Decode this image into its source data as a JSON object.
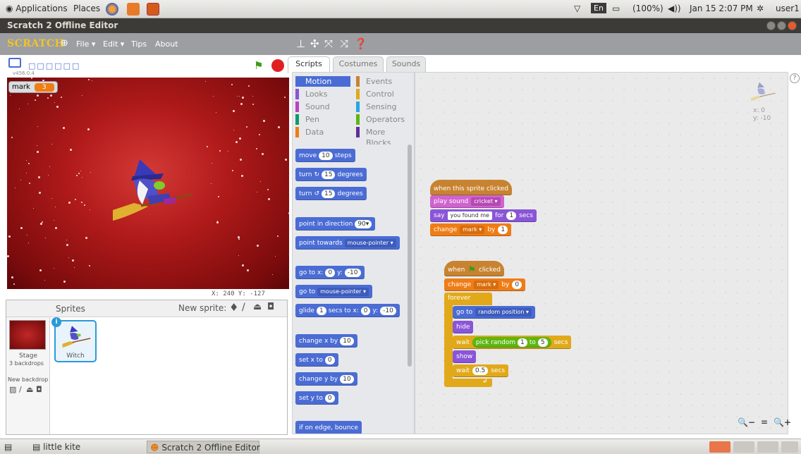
{
  "os_panel": {
    "applications": "Applications",
    "places": "Places",
    "keyboard_layout": "En",
    "battery": "(100%)",
    "datetime": "Jan 15  2:07 PM",
    "user": "user1"
  },
  "window": {
    "title": "Scratch 2 Offline Editor"
  },
  "menubar": {
    "logo": "SCRATCH",
    "file": "File ▾",
    "edit": "Edit ▾",
    "tips": "Tips",
    "about": "About"
  },
  "stage": {
    "version": "v456.0.4",
    "variable_monitor": {
      "name": "mark",
      "value": "3"
    },
    "mouse_coords": "X: 240  Y: -127"
  },
  "sprites_panel": {
    "title": "Sprites",
    "new_sprite": "New sprite:",
    "stage_label": "Stage",
    "stage_backdrops": "3 backdrops",
    "new_backdrop": "New backdrop:",
    "sprites": [
      {
        "name": "Witch"
      }
    ]
  },
  "tabs": [
    "Scripts",
    "Costumes",
    "Sounds"
  ],
  "categories": {
    "left": [
      {
        "name": "Motion",
        "color": "#4a6cd4"
      },
      {
        "name": "Looks",
        "color": "#8a55d7"
      },
      {
        "name": "Sound",
        "color": "#bb42c3"
      },
      {
        "name": "Pen",
        "color": "#0e9a6c"
      },
      {
        "name": "Data",
        "color": "#ee7d16"
      }
    ],
    "right": [
      {
        "name": "Events",
        "color": "#c88330"
      },
      {
        "name": "Control",
        "color": "#e1a91a"
      },
      {
        "name": "Sensing",
        "color": "#2ca5e2"
      },
      {
        "name": "Operators",
        "color": "#5cb712"
      },
      {
        "name": "More Blocks",
        "color": "#632d99"
      }
    ]
  },
  "palette_blocks": {
    "move": {
      "a": "move",
      "v": "10",
      "b": "steps"
    },
    "turn_cw": {
      "a": "turn",
      "v": "15",
      "b": "degrees"
    },
    "turn_ccw": {
      "a": "turn",
      "v": "15",
      "b": "degrees"
    },
    "point_dir": {
      "a": "point in direction",
      "v": "90▾"
    },
    "point_towards": {
      "a": "point towards",
      "v": "mouse-pointer ▾"
    },
    "goto_xy": {
      "a": "go to x:",
      "v1": "0",
      "b": "y:",
      "v2": "-10"
    },
    "goto": {
      "a": "go to",
      "v": "mouse-pointer ▾"
    },
    "glide": {
      "a": "glide",
      "v1": "1",
      "b": "secs to x:",
      "v2": "0",
      "c": "y:",
      "v3": "-10"
    },
    "change_x": {
      "a": "change x by",
      "v": "10"
    },
    "set_x": {
      "a": "set x to",
      "v": "0"
    },
    "change_y": {
      "a": "change y by",
      "v": "10"
    },
    "set_y": {
      "a": "set y to",
      "v": "0"
    },
    "bounce": {
      "a": "if on edge, bounce"
    }
  },
  "script1": {
    "hat": "when this sprite clicked",
    "play_sound": {
      "a": "play sound",
      "v": "cricket ▾"
    },
    "say": {
      "a": "say",
      "v1": "you found me",
      "b": "for",
      "v2": "1",
      "c": "secs"
    },
    "change": {
      "a": "change",
      "v1": "mark ▾",
      "b": "by",
      "v2": "1"
    }
  },
  "script2": {
    "hat_a": "when",
    "hat_b": "clicked",
    "change": {
      "a": "change",
      "v1": "mark ▾",
      "b": "by",
      "v2": "0"
    },
    "forever": "forever",
    "goto": {
      "a": "go to",
      "v": "random position ▾"
    },
    "hide": "hide",
    "wait_random": {
      "a": "wait",
      "op": "pick random",
      "v1": "1",
      "b": "to",
      "v2": "5",
      "c": "secs"
    },
    "show": "show",
    "wait": {
      "a": "wait",
      "v": "0.5",
      "b": "secs"
    }
  },
  "sprite_info": {
    "x": "x: 0",
    "y": "y: -10"
  },
  "zoom": {
    "out": "🔍−",
    "reset": "=",
    "in": "🔍+"
  },
  "taskbar": {
    "task1": "little kite",
    "task2": "Scratch 2 Offline Editor"
  }
}
